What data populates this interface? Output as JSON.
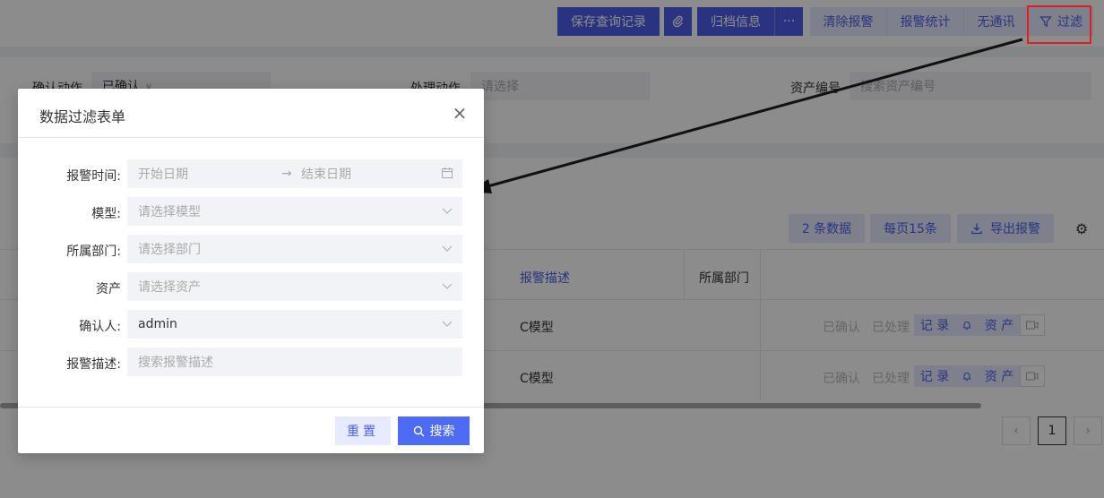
{
  "toolbar": {
    "save_query": "保存查询记录",
    "archive": "归档信息",
    "more": "···",
    "clear_alarm": "清除报警",
    "alarm_stats": "报警统计",
    "no_comm": "无通讯",
    "filter": "过滤"
  },
  "filters": {
    "confirm_action_label": "确认动作",
    "confirm_action_value": "已确认",
    "handle_action_label": "处理动作",
    "handle_action_placeholder": "请选择",
    "asset_no_label": "资产编号",
    "asset_no_placeholder": "搜索资产编号"
  },
  "table": {
    "count": "2 条数据",
    "per_page": "每页15条",
    "export": "导出报警",
    "headers": {
      "desc": "报警描述",
      "dept": "所属部门"
    },
    "rows": [
      {
        "desc": "C模型"
      },
      {
        "desc": "C模型"
      }
    ],
    "actions": {
      "confirmed": "已确认",
      "handled": "已处理",
      "record": "记 录",
      "asset": "资 产"
    },
    "page": "1"
  },
  "modal": {
    "title": "数据过滤表单",
    "alarm_time_label": "报警时间:",
    "start_date_placeholder": "开始日期",
    "end_date_placeholder": "结束日期",
    "model_label": "模型:",
    "model_placeholder": "请选择模型",
    "dept_label": "所属部门:",
    "dept_placeholder": "请选择部门",
    "asset_label": "资产",
    "asset_placeholder": "请选择资产",
    "confirmer_label": "确认人:",
    "confirmer_value": "admin",
    "desc_label": "报警描述:",
    "desc_placeholder": "搜索报警描述",
    "reset": "重置",
    "search": "搜索"
  }
}
